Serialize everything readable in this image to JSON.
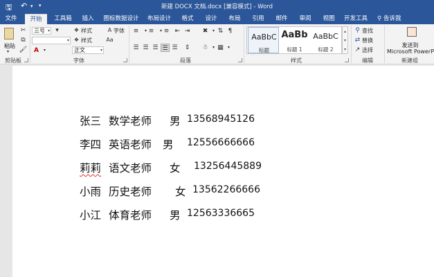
{
  "window": {
    "title": "新建 DOCX 文档.docx [兼容模式] - Word"
  },
  "quick_access": {
    "save_icon": "save-icon",
    "undo_icon": "undo-icon",
    "customize_icon": "customize-quick-access-icon"
  },
  "tabs": [
    {
      "label": "文件"
    },
    {
      "label": "开始"
    },
    {
      "label": "工具箱"
    },
    {
      "label": "插入"
    },
    {
      "label": "图标数据设计"
    },
    {
      "label": "布局设计"
    },
    {
      "label": "格式"
    },
    {
      "label": "设计"
    },
    {
      "label": "布局"
    },
    {
      "label": "引用"
    },
    {
      "label": "邮件"
    },
    {
      "label": "审阅"
    },
    {
      "label": "视图"
    },
    {
      "label": "开发工具"
    }
  ],
  "tell_me": "告诉我",
  "ribbon": {
    "clipboard": {
      "paste_label": "粘贴",
      "group_label": "剪贴板"
    },
    "font": {
      "font_size_value": "三号",
      "font_name_value": "",
      "style_value": "正文",
      "style_label_1": "样式",
      "style_label_2": "样式",
      "font_label": "字体",
      "group_label": "字体"
    },
    "paragraph": {
      "group_label": "段落"
    },
    "styles": {
      "items": [
        {
          "preview": "AaBbC",
          "name": "标题"
        },
        {
          "preview": "AaBb",
          "name": "标题 1"
        },
        {
          "preview": "AaBbC",
          "name": "标题 2"
        }
      ],
      "group_label": "样式"
    },
    "editing": {
      "find_label": "查找",
      "replace_label": "替换",
      "select_label": "选择",
      "group_label": "编辑"
    },
    "new_group": {
      "send_label_1": "发送到",
      "send_label_2": "Microsoft PowerPoint",
      "group_label": "新建组"
    }
  },
  "document": {
    "rows": [
      {
        "name": "张三",
        "subject": "数学老师",
        "gender": "男",
        "phone": "13568945126"
      },
      {
        "name": "李四",
        "subject": "英语老师",
        "gender": "男",
        "phone": "12556666666"
      },
      {
        "name": "莉莉",
        "subject": "语文老师",
        "gender": "女",
        "phone": "13256445889"
      },
      {
        "name": "小雨",
        "subject": "历史老师",
        "gender": "女",
        "phone": "13562266666"
      },
      {
        "name": "小江",
        "subject": "体育老师",
        "gender": "男",
        "phone": "12563336665"
      }
    ]
  },
  "colors": {
    "title_bar": "#2b579a",
    "ribbon_bg": "#f3f3f3",
    "spell_error": "#d33"
  }
}
